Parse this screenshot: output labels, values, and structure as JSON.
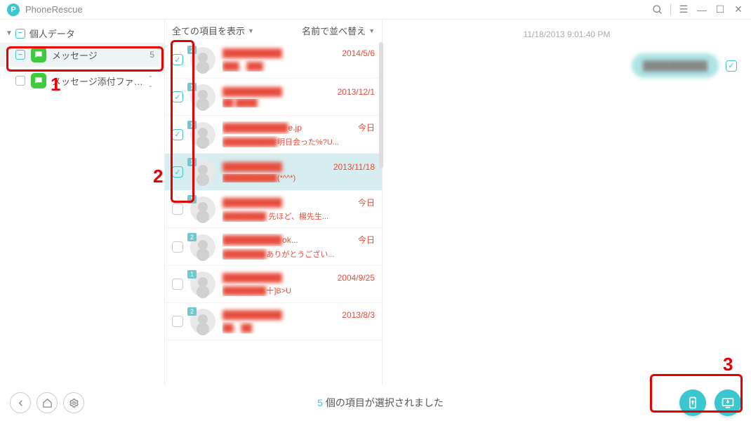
{
  "app": {
    "title": "PhoneRescue"
  },
  "sidebar": {
    "category": "個人データ",
    "items": [
      {
        "label": "メッセージ",
        "count": "5"
      },
      {
        "label": "メッセージ添付ファイル",
        "count": "--"
      }
    ]
  },
  "mid": {
    "showAll": "全ての項目を表示",
    "sortBy": "名前で並べ替え",
    "rows": [
      {
        "badge": "2",
        "name": "██████████",
        "date": "2014/5/6",
        "preview_blur": "███、███",
        "preview_clear": ""
      },
      {
        "badge": "1",
        "name": "██████████",
        "date": "2013/12/1",
        "preview_blur": "██ ████",
        "preview_clear": ""
      },
      {
        "badge": "1",
        "name": "███████████",
        "name_suffix": "e.jp",
        "date": "今日",
        "preview_blur": "██████████",
        "preview_clear": "明日会った%?U..."
      },
      {
        "badge": "1",
        "name": "██████████",
        "date": "2013/11/18",
        "preview_blur": "██████████",
        "preview_clear": "(*^^*)"
      },
      {
        "badge": "1",
        "name": "██████████",
        "date": "今日",
        "preview_blur": "████████",
        "preview_clear": " 先ほど、楊先生..."
      },
      {
        "badge": "2",
        "name": "██████████",
        "name_suffix": "ok...",
        "date": "今日",
        "preview_blur": "████████",
        "preview_clear": "ありがとうござい..."
      },
      {
        "badge": "1",
        "name": "██████████",
        "date": "2004/9/25",
        "preview_blur": "████████",
        "preview_clear": "十]B>U"
      },
      {
        "badge": "2",
        "name": "██████████",
        "date": "2013/8/3",
        "preview_blur": "██、██",
        "preview_clear": ""
      }
    ]
  },
  "right": {
    "timestamp": "11/18/2013 9:01:40 PM",
    "bubble": "██████████"
  },
  "footer": {
    "count": "5",
    "status_text": " 個の項目が選択されました"
  },
  "annotations": {
    "n1": "1",
    "n2": "2",
    "n3": "3"
  }
}
